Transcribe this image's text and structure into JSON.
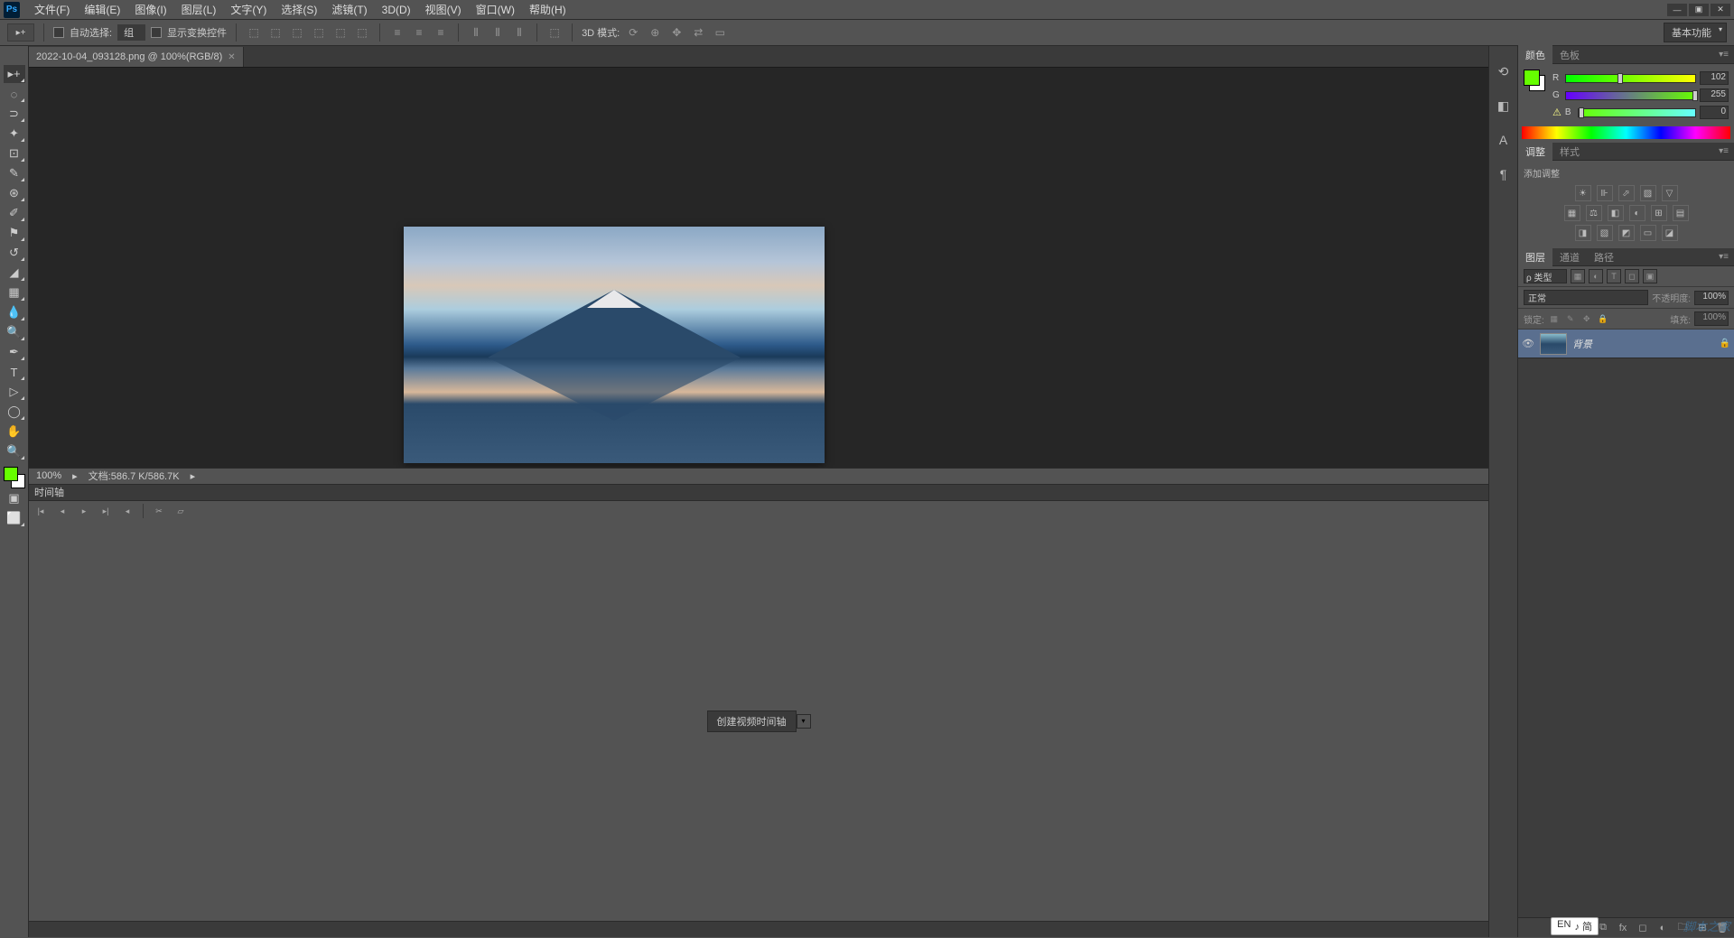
{
  "menu": {
    "file": "文件(F)",
    "edit": "编辑(E)",
    "image": "图像(I)",
    "layer": "图层(L)",
    "type": "文字(Y)",
    "select": "选择(S)",
    "filter": "滤镜(T)",
    "3d": "3D(D)",
    "view": "视图(V)",
    "window": "窗口(W)",
    "help": "帮助(H)"
  },
  "options": {
    "autoSelect": "自动选择:",
    "group": "组",
    "showTransform": "显示变换控件",
    "mode3d": "3D 模式:"
  },
  "workspace": "基本功能",
  "docTab": "2022-10-04_093128.png @ 100%(RGB/8)",
  "status": {
    "zoom": "100%",
    "doc": "文档:586.7 K/586.7K"
  },
  "timeline": {
    "title": "时间轴",
    "create": "创建视频时间轴"
  },
  "colorPanel": {
    "tab1": "颜色",
    "tab2": "色板",
    "r": "R",
    "g": "G",
    "b": "B",
    "rv": "102",
    "gv": "255",
    "bv": "0"
  },
  "adjustPanel": {
    "tab1": "调整",
    "tab2": "样式",
    "add": "添加调整"
  },
  "layersPanel": {
    "tab1": "图层",
    "tab2": "通道",
    "tab3": "路径",
    "kind": "ρ 类型",
    "blend": "正常",
    "opacityLbl": "不透明度:",
    "opacityVal": "100%",
    "lockLbl": "锁定:",
    "fillLbl": "填充:",
    "fillVal": "100%",
    "layerName": "背景"
  },
  "ime": {
    "lang": "EN",
    "extra": "♪ 简"
  }
}
